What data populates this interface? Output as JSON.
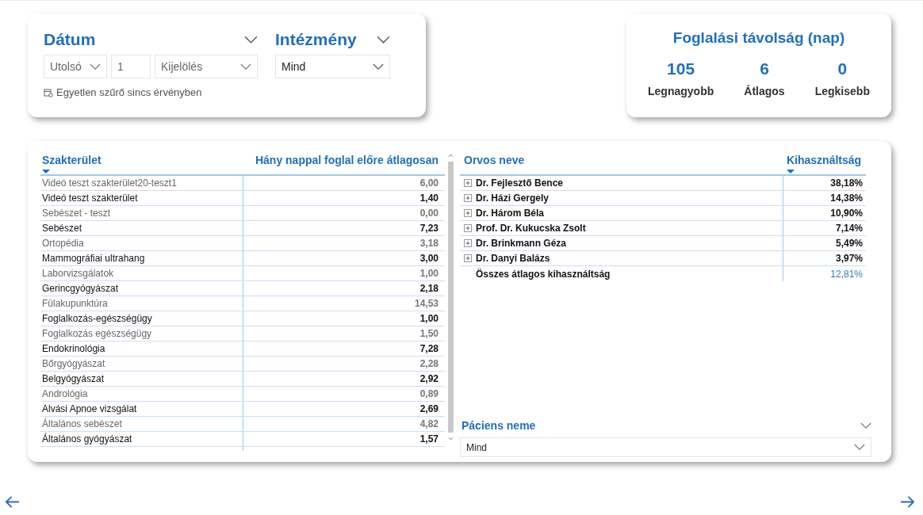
{
  "date_filter": {
    "title": "Dátum",
    "mode": "Utolsó",
    "count": "1",
    "unit": "Kijelölés",
    "note": "Egyetlen szűrő sincs érvényben"
  },
  "institution_filter": {
    "title": "Intézmény",
    "value": "Mind"
  },
  "booking_distance": {
    "title": "Foglalási távolság (nap)",
    "stats": [
      {
        "value": "105",
        "label": "Legnagyobb"
      },
      {
        "value": "6",
        "label": "Átlagos"
      },
      {
        "value": "0",
        "label": "Legkisebb"
      }
    ]
  },
  "specialty_table": {
    "columns": [
      "Szakterület",
      "Hány nappal foglal előre átlagosan"
    ],
    "rows": [
      [
        "Videó teszt szakterület20-teszt1",
        "6,00"
      ],
      [
        "Videó teszt szakterület",
        "1,40"
      ],
      [
        "Sebészet - teszt",
        "0,00"
      ],
      [
        "Sebészet",
        "7,23"
      ],
      [
        "Ortopédia",
        "3,18"
      ],
      [
        "Mammográfiai ultrahang",
        "3,00"
      ],
      [
        "Laborvizsgálatok",
        "1,00"
      ],
      [
        "Gerincgyógyászat",
        "2,18"
      ],
      [
        "Fülakupunktúra",
        "14,53"
      ],
      [
        "Foglalkozás-egészségügy",
        "1,00"
      ],
      [
        "Foglalkozás egészségügy",
        "1,50"
      ],
      [
        "Endokrinológia",
        "7,28"
      ],
      [
        "Bőrgyógyászat",
        "2,28"
      ],
      [
        "Belgyógyászat",
        "2,92"
      ],
      [
        "Andrológia",
        "0,89"
      ],
      [
        "Alvási Apnoe vizsgálat",
        "2,69"
      ],
      [
        "Általános sebészet",
        "4,82"
      ],
      [
        "Általános gyógyászat",
        "1,57"
      ]
    ]
  },
  "doctor_table": {
    "columns": [
      "Orvos neve",
      "Kihasználtság"
    ],
    "rows": [
      {
        "name": "Dr. Fejlesztő Bence",
        "value": "38,18%",
        "expanded": false
      },
      {
        "name": "Dr. Házi Gergely",
        "value": "14,38%",
        "expanded": false
      },
      {
        "name": "Dr. Három Béla",
        "value": "10,90%",
        "expanded": false
      },
      {
        "name": "Prof. Dr. Kukucska Zsolt",
        "value": "7,14%",
        "expanded": false
      },
      {
        "name": "Dr. Brinkmann Géza",
        "value": "5,49%",
        "expanded": false
      },
      {
        "name": "Dr. Danyi Balázs",
        "value": "3,97%",
        "expanded": false
      }
    ],
    "total": {
      "label": "Összes átlagos kihasználtság",
      "value": "12,81%"
    }
  },
  "patient_filter": {
    "title": "Páciens neme",
    "value": "Mind"
  }
}
